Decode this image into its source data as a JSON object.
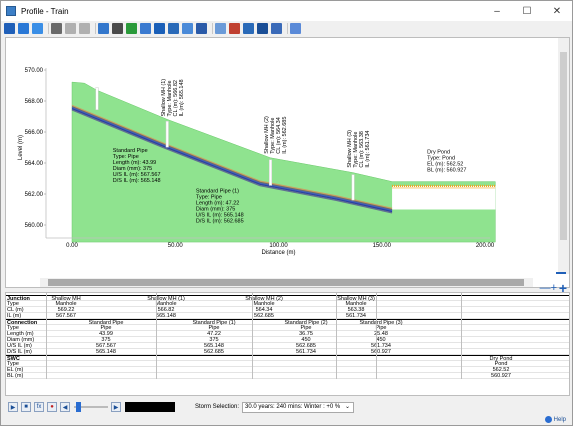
{
  "window": {
    "title": "Profile - Train",
    "minimize": "–",
    "maximize": "☐",
    "close": "✕"
  },
  "toolbar": {
    "icons": [
      "select-icon",
      "pan-icon",
      "crosshair-icon",
      "grid-icon",
      "undo-icon",
      "redo-icon",
      "profile-icon",
      "layers-icon",
      "tools-icon",
      "link-icon",
      "pipe-icon",
      "manhole-icon",
      "table-icon",
      "chart-icon",
      "settings-icon",
      "flow-icon",
      "export-icon",
      "save-icon",
      "print-icon",
      "refresh-icon"
    ]
  },
  "chart_data": {
    "type": "area",
    "xlabel": "Distance (m)",
    "ylabel": "Level (m)",
    "xlim": [
      0,
      200
    ],
    "ylim": [
      560,
      570
    ],
    "xticks": [
      "0.00",
      "50.00",
      "100.00",
      "150.00",
      "200.00"
    ],
    "yticks": [
      "560.00",
      "562.00",
      "564.00",
      "566.00",
      "568.00",
      "570.00"
    ],
    "ground": [
      [
        0,
        569.22
      ],
      [
        6,
        569.15
      ],
      [
        12,
        568.7
      ],
      [
        46,
        566.82
      ],
      [
        96,
        564.34
      ],
      [
        136,
        563.38
      ],
      [
        155,
        562.8
      ],
      [
        205,
        562.8
      ]
    ],
    "pipe": [
      [
        0,
        567.567
      ],
      [
        44,
        565.148
      ],
      [
        91,
        562.685
      ],
      [
        128,
        561.734
      ],
      [
        155,
        560.927
      ]
    ],
    "pond_level": 562.52,
    "annotations": [
      {
        "lines": [
          "Shallow MH (1)",
          "Type: Manhole",
          "CL (m): 566.82",
          "IL (m): 565.148"
        ]
      },
      {
        "lines": [
          "Shallow MH (2)",
          "Type: Manhole",
          "CL (m): 564.34",
          "IL (m): 562.685"
        ]
      },
      {
        "lines": [
          "Shallow MH (3)",
          "Type: Manhole",
          "CL (m): 563.38",
          "IL (m): 561.734"
        ]
      },
      {
        "lines": [
          "Standard Pipe",
          "Type: Pipe",
          "Length (m): 43.99",
          "Diam (mm): 375",
          "U/S IL (m): 567.567",
          "D/S IL (m): 565.148"
        ]
      },
      {
        "lines": [
          "Standard Pipe (1)",
          "Type: Pipe",
          "Length (m): 47.22",
          "Diam (mm): 375",
          "U/S IL (m): 565.148",
          "D/S IL (m): 562.685"
        ]
      },
      {
        "lines": [
          "Dry Pond",
          "Type: Pond",
          "EL (m): 562.52",
          "BL (m): 560.927"
        ]
      }
    ]
  },
  "table": {
    "junction": {
      "label": "Junction",
      "rows": [
        "Type",
        "CL (m)",
        "IL (m)"
      ],
      "cols": [
        [
          "Shallow MH",
          "Manhole",
          "569.22",
          "567.567"
        ],
        [
          "Shallow MH (1)",
          "Manhole",
          "566.82",
          "565.148"
        ],
        [
          "Shallow MH (2)",
          "Manhole",
          "564.34",
          "562.685"
        ],
        [
          "Shallow MH (3)",
          "Manhole",
          "563.38",
          "561.734"
        ]
      ]
    },
    "connection": {
      "label": "Connection",
      "rows": [
        "Type",
        "Length (m)",
        "Diam (mm)",
        "U/S IL (m)",
        "D/S IL (m)"
      ],
      "cols": [
        [
          "Standard Pipe",
          "Pipe",
          "43.99",
          "375",
          "567.567",
          "565.148"
        ],
        [
          "Standard Pipe (1)",
          "Pipe",
          "47.22",
          "375",
          "565.148",
          "562.685"
        ],
        [
          "Standard Pipe (2)",
          "Pipe",
          "36.75",
          "450",
          "562.685",
          "561.734"
        ],
        [
          "Standard Pipe (3)",
          "Pipe",
          "25.48",
          "450",
          "561.734",
          "560.927"
        ]
      ]
    },
    "swc": {
      "label": "SWC",
      "rows": [
        "Type",
        "EL (m)",
        "BL (m)"
      ],
      "cols": [
        [
          "Dry Pond",
          "Pond",
          "562.52",
          "560.927"
        ]
      ]
    }
  },
  "player": {
    "storm_label": "Storm Selection:",
    "storm_value": "30.0 years: 240 mins: Winter : +0 %",
    "help": "Help"
  }
}
